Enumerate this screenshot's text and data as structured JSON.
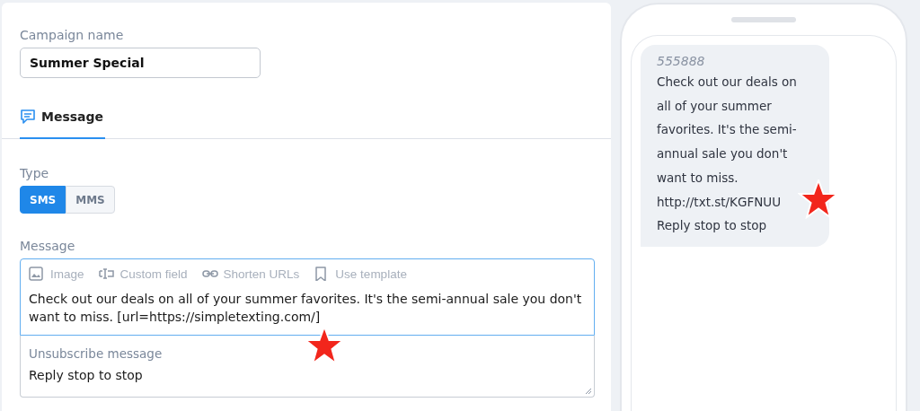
{
  "campaign_name": {
    "label": "Campaign name",
    "value": "Summer Special"
  },
  "tabs": [
    {
      "label": "Message",
      "selected": true
    }
  ],
  "type": {
    "label": "Type",
    "options": [
      {
        "label": "SMS",
        "selected": true
      },
      {
        "label": "MMS",
        "selected": false
      }
    ]
  },
  "message": {
    "label": "Message",
    "toolbar": [
      {
        "kind": "image",
        "label": "Image"
      },
      {
        "kind": "field",
        "label": "Custom field"
      },
      {
        "kind": "link",
        "label": "Shorten URLs"
      },
      {
        "kind": "bookmark",
        "label": "Use template"
      }
    ],
    "value": "Check out our deals on all of your summer favorites. It's the semi-annual sale you don't want to miss. [url=https://simpletexting.com/]",
    "unsubscribe_label": "Unsubscribe message",
    "unsubscribe_value": "Reply stop to stop",
    "starred": true
  },
  "preview": {
    "sender": "555888",
    "lines": [
      "Check out our deals on",
      "all of your summer",
      "favorites. It's the semi-",
      "annual sale you don't",
      "want to miss.",
      "http://txt.st/KGFNUU",
      "Reply stop to stop"
    ],
    "starred": true
  }
}
